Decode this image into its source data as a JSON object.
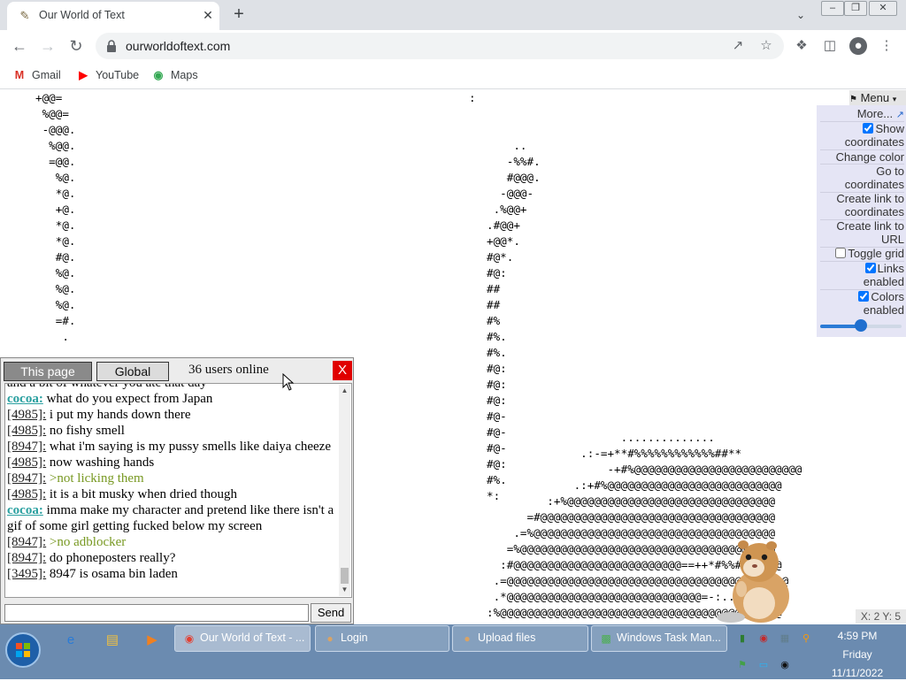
{
  "browser": {
    "tab_title": "Our World of Text",
    "tab_favicon": "scroll-icon",
    "url": "ourworldoftext.com",
    "bookmarks": [
      {
        "label": "Gmail",
        "icon": "gmail-icon",
        "color": "#d93025"
      },
      {
        "label": "YouTube",
        "icon": "youtube-icon",
        "color": "#ff0000"
      },
      {
        "label": "Maps",
        "icon": "maps-icon",
        "color": "#34a853"
      }
    ]
  },
  "canvas": {
    "left_art": "+@@=\n %@@=\n -@@@.\n  %@@.\n  =@@.\n   %@.\n   *@.\n   +@.\n   *@.\n   *@.\n   #@.\n   %@.\n   %@.\n   %@.\n   =#.\n    .",
    "colon": ":",
    "center_art": "\n\n\n    ..\n   -%%#.\n   #@@@.\n  -@@@-\n .%@@+\n.#@@+\n+@@*.\n#@*.\n#@:\n##\n##\n#%\n#%.\n#%.\n#@:\n#@:\n#@:\n#@-\n#@-\n#@-\n#@:\n#%.\n*:",
    "right_art": "                    ..............\n              .:-=+**#%%%%%%%%%%%%##**\n                  -+#%@@@@@@@@@@@@@@@@@@@@@@@@@\n             .:+#%@@@@@@@@@@@@@@@@@@@@@@@@@@\n         :+%@@@@@@@@@@@@@@@@@@@@@@@@@@@@@@@\n      =#@@@@@@@@@@@@@@@@@@@@@@@@@@@@@@@@@@@\n    .=%@@@@@@@@@@@@@@@@@@@@@@@@@@@@@@@@@@@@\n   =%@@@@@@@@@@@@@@@@@@@@@@@@@@@@@@@@@@@@@@\n  :#@@@@@@@@@@@@@@@@@@@@@@@@@==++*#%%#%@@@@@\n .=@@@@@@@@@@@@@@@@@@@@@@@@@@@@@@@@@@@+@@@@@@\n .*@@@@@@@@@@@@@@@@@@@@@@@@@@@@@=-:...:*@@@@@\n:%@@@@@@@@@@@@@@@@@@@@@@@@@@@@@@@@@@@@@@@@@@"
  },
  "menu": {
    "header": "Menu",
    "more": "More...",
    "show_coordinates": "Show coordinates",
    "change_color": "Change color",
    "go_to_coordinates": "Go to coordinates",
    "create_link_coordinates": "Create link to coordinates",
    "create_link_url": "Create link to URL",
    "toggle_grid": "Toggle grid",
    "links_enabled": "Links enabled",
    "colors_enabled": "Colors enabled",
    "zoom_fraction": 0.5
  },
  "chat": {
    "tab_this_page": "This page",
    "tab_global": "Global",
    "users_online": "36 users online",
    "close": "X",
    "send": "Send",
    "input_value": "",
    "messages": [
      {
        "nick": "",
        "text": "and a bit of whatever you ate that day",
        "style": "normal"
      },
      {
        "nick": "cocoa:",
        "text": "what do you expect from Japan",
        "style": "normal",
        "registered": true
      },
      {
        "nick": "[4985]:",
        "text": "i put my hands down there",
        "style": "normal"
      },
      {
        "nick": "[4985]:",
        "text": "no fishy smell",
        "style": "normal"
      },
      {
        "nick": "[8947]:",
        "text": "what i'm saying is my pussy smells like daiya cheeze",
        "style": "normal"
      },
      {
        "nick": "[4985]:",
        "text": "now washing hands",
        "style": "normal"
      },
      {
        "nick": "[8947]:",
        "text": ">not licking them",
        "style": "greentext"
      },
      {
        "nick": "[4985]:",
        "text": "it is a bit musky when dried though",
        "style": "normal"
      },
      {
        "nick": "cocoa:",
        "text": "imma make my character and pretend like there isn't a gif of some girl getting fucked below my screen",
        "style": "normal",
        "registered": true
      },
      {
        "nick": "[8947]:",
        "text": ">no adblocker",
        "style": "greentext"
      },
      {
        "nick": "[8947]:",
        "text": "do phoneposters really?",
        "style": "normal"
      },
      {
        "nick": "[3495]:",
        "text": "8947 is osama bin laden",
        "style": "normal"
      }
    ]
  },
  "coords_readout": "X: 2 Y: 5",
  "taskbar": {
    "tasks": [
      {
        "label": "Our World of Text - ...",
        "icon": "chrome-icon",
        "active": true
      },
      {
        "label": "Login",
        "icon": "hamster-icon",
        "active": false
      },
      {
        "label": "Upload files",
        "icon": "hamster-icon",
        "active": false
      },
      {
        "label": "Windows Task Man...",
        "icon": "task-manager-icon",
        "active": false
      }
    ],
    "time": "4:59 PM",
    "day": "Friday",
    "date": "11/11/2022"
  }
}
